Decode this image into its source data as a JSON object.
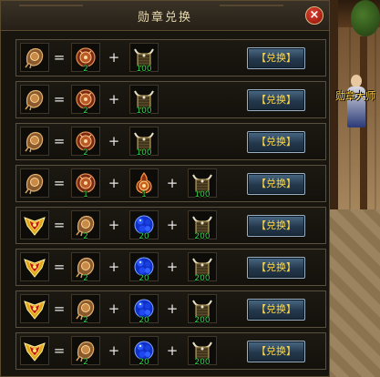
{
  "dialog": {
    "title": "勋章兑换",
    "close_label": "×"
  },
  "npc": {
    "name": "勋章大师"
  },
  "exchange_button_label": "【兑换】",
  "rows": [
    {
      "result": "medal-bronze",
      "inputs": [
        {
          "item": "round-medal",
          "qty": "2"
        },
        {
          "item": "horn-token",
          "qty": "100"
        }
      ]
    },
    {
      "result": "medal-bronze",
      "inputs": [
        {
          "item": "round-medal",
          "qty": "2"
        },
        {
          "item": "horn-token",
          "qty": "100"
        }
      ]
    },
    {
      "result": "medal-bronze",
      "inputs": [
        {
          "item": "round-medal",
          "qty": "2"
        },
        {
          "item": "horn-token",
          "qty": "100"
        }
      ]
    },
    {
      "result": "medal-bronze",
      "inputs": [
        {
          "item": "round-medal",
          "qty": "1"
        },
        {
          "item": "flame-medal",
          "qty": "1"
        },
        {
          "item": "horn-token",
          "qty": "100"
        }
      ]
    },
    {
      "result": "medal-gold",
      "inputs": [
        {
          "item": "medal-bronze",
          "qty": "2"
        },
        {
          "item": "blue-gem",
          "qty": "20"
        },
        {
          "item": "horn-token",
          "qty": "200"
        }
      ]
    },
    {
      "result": "medal-gold",
      "inputs": [
        {
          "item": "medal-bronze",
          "qty": "2"
        },
        {
          "item": "blue-gem",
          "qty": "20"
        },
        {
          "item": "horn-token",
          "qty": "200"
        }
      ]
    },
    {
      "result": "medal-gold",
      "inputs": [
        {
          "item": "medal-bronze",
          "qty": "2"
        },
        {
          "item": "blue-gem",
          "qty": "20"
        },
        {
          "item": "horn-token",
          "qty": "200"
        }
      ]
    },
    {
      "result": "medal-gold",
      "inputs": [
        {
          "item": "medal-bronze",
          "qty": "2"
        },
        {
          "item": "blue-gem",
          "qty": "20"
        },
        {
          "item": "horn-token",
          "qty": "200"
        }
      ]
    }
  ],
  "colors": {
    "quantity_text": "#2fd84a",
    "button_text": "#ffd84a"
  }
}
